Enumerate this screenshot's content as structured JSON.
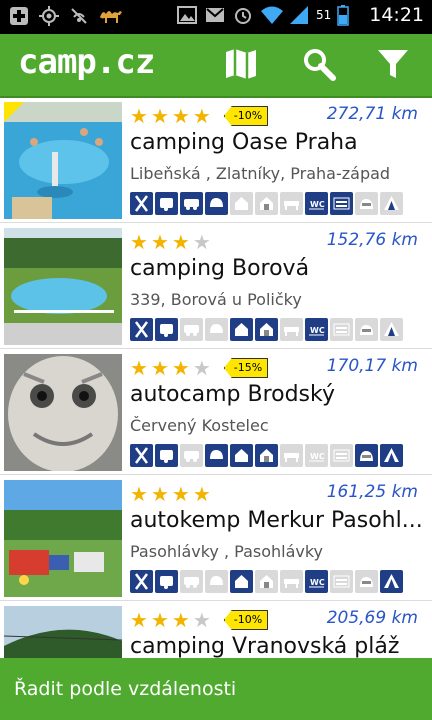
{
  "statusbar": {
    "time": "14:21",
    "battery_pct": "51",
    "icons": [
      "add-box-icon",
      "gps-icon",
      "signal-off-icon",
      "camel-icon",
      "image-icon",
      "gmail-icon",
      "alarm-icon",
      "wifi-icon",
      "cell-signal-icon",
      "battery-icon"
    ]
  },
  "appbar": {
    "logo": "camp.cz",
    "actions": [
      "map-icon",
      "search-icon",
      "filter-icon"
    ]
  },
  "list": {
    "items": [
      {
        "name": "camping Oase Praha",
        "address": "Libeňská , Zlatníky, Praha-západ",
        "distance": "272,71 km",
        "stars": 4,
        "discount": "-10%",
        "corner_badge": true,
        "amenities": [
          1,
          1,
          1,
          1,
          0,
          0,
          0,
          1,
          1,
          0,
          0
        ],
        "thumb": "pool"
      },
      {
        "name": "camping Borová",
        "address": " 339, Borová u Poličky",
        "distance": "152,76 km",
        "stars": 3,
        "discount": "",
        "corner_badge": false,
        "amenities": [
          1,
          1,
          0,
          0,
          1,
          1,
          0,
          1,
          0,
          0,
          0
        ],
        "thumb": "pool2"
      },
      {
        "name": "autocamp Brodský",
        "address": "Červený Kostelec",
        "distance": "170,17 km",
        "stars": 3,
        "discount": "-15%",
        "corner_badge": false,
        "amenities": [
          1,
          1,
          0,
          1,
          1,
          1,
          0,
          0,
          0,
          1,
          1
        ],
        "thumb": "statue"
      },
      {
        "name": "autokemp Merkur Pasohl...",
        "address": "Pasohlávky , Pasohlávky",
        "distance": "161,25 km",
        "stars": 4,
        "discount": "",
        "corner_badge": false,
        "amenities": [
          1,
          1,
          0,
          0,
          1,
          0,
          0,
          1,
          0,
          0,
          1
        ],
        "thumb": "camp"
      },
      {
        "name": "camping Vranovská pláž",
        "address": "",
        "distance": "205,69 km",
        "stars": 3,
        "discount": "-10%",
        "corner_badge": false,
        "amenities": [],
        "thumb": "lake"
      }
    ]
  },
  "bottombar": {
    "sort_label": "Řadit podle vzdálenosti"
  }
}
